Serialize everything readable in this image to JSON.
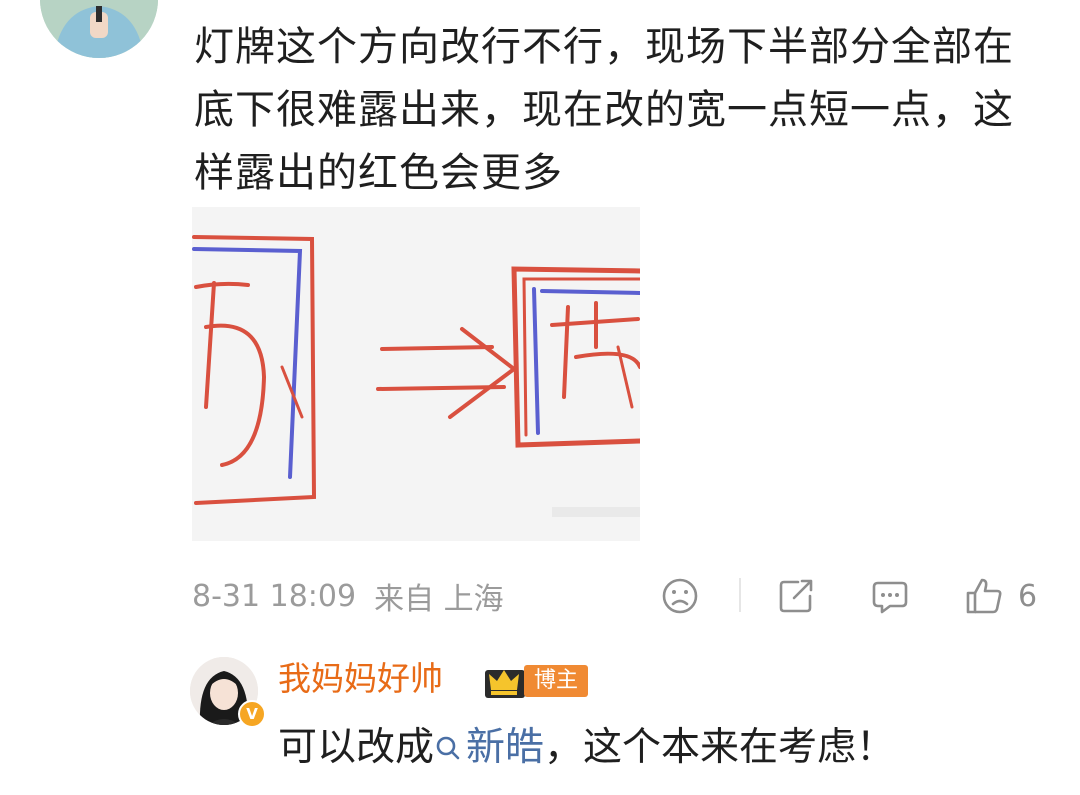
{
  "comment": {
    "text": "灯牌这个方向改行不行，现场下半部分全部在底下很难露出来，现在改的宽一点短一点，这样露出的红色会更多",
    "time": "8-31 18:09",
    "source": "来自 上海",
    "like_count": "6"
  },
  "actions": {
    "emoji_icon": "emoji-sad-icon",
    "share_icon": "share-icon",
    "comment_icon": "comment-icon",
    "like_icon": "thumbs-up-icon"
  },
  "reply": {
    "username": "我妈妈好帅",
    "badge_label": "博主",
    "verified_mark": "V",
    "text_before": "可以改成",
    "search_term": "新皓",
    "text_after": "，这个本来在考虑！"
  },
  "colors": {
    "username": "#e86b17",
    "blogger_tag": "#f08a33",
    "search_link": "#4a6fa5",
    "meta_text": "#9b9b9b",
    "sketch_red": "#d9503f",
    "sketch_blue": "#5a5fd0"
  }
}
